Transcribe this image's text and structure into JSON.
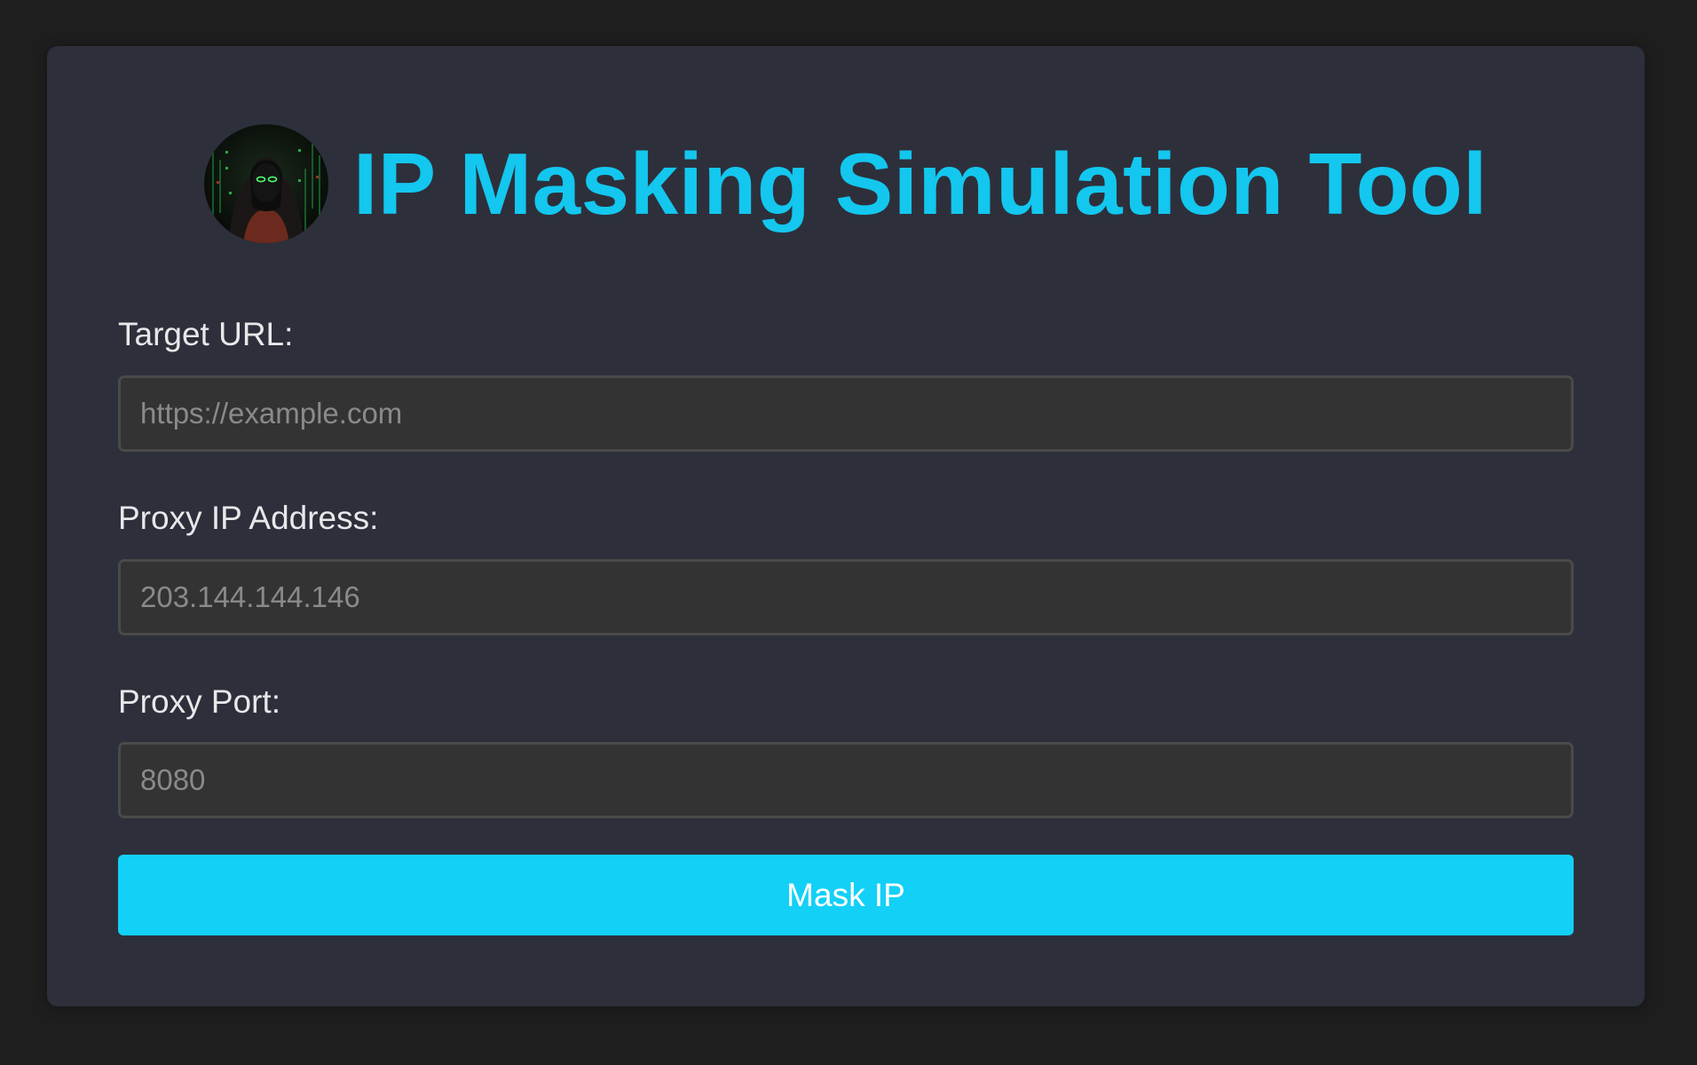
{
  "header": {
    "title": "IP Masking Simulation Tool",
    "avatar_icon": "hooded-hacker-avatar"
  },
  "form": {
    "target_url": {
      "label": "Target URL:",
      "placeholder": "https://example.com",
      "value": ""
    },
    "proxy_ip": {
      "label": "Proxy IP Address:",
      "placeholder": "203.144.144.146",
      "value": ""
    },
    "proxy_port": {
      "label": "Proxy Port:",
      "placeholder": "8080",
      "value": ""
    },
    "submit_label": "Mask IP"
  },
  "colors": {
    "page_background": "#1e1e1f",
    "card_background": "#2d303b",
    "accent": "#13c7ef",
    "button": "#13d0f7",
    "input_background": "#333333",
    "input_border": "#4a4a4a"
  }
}
